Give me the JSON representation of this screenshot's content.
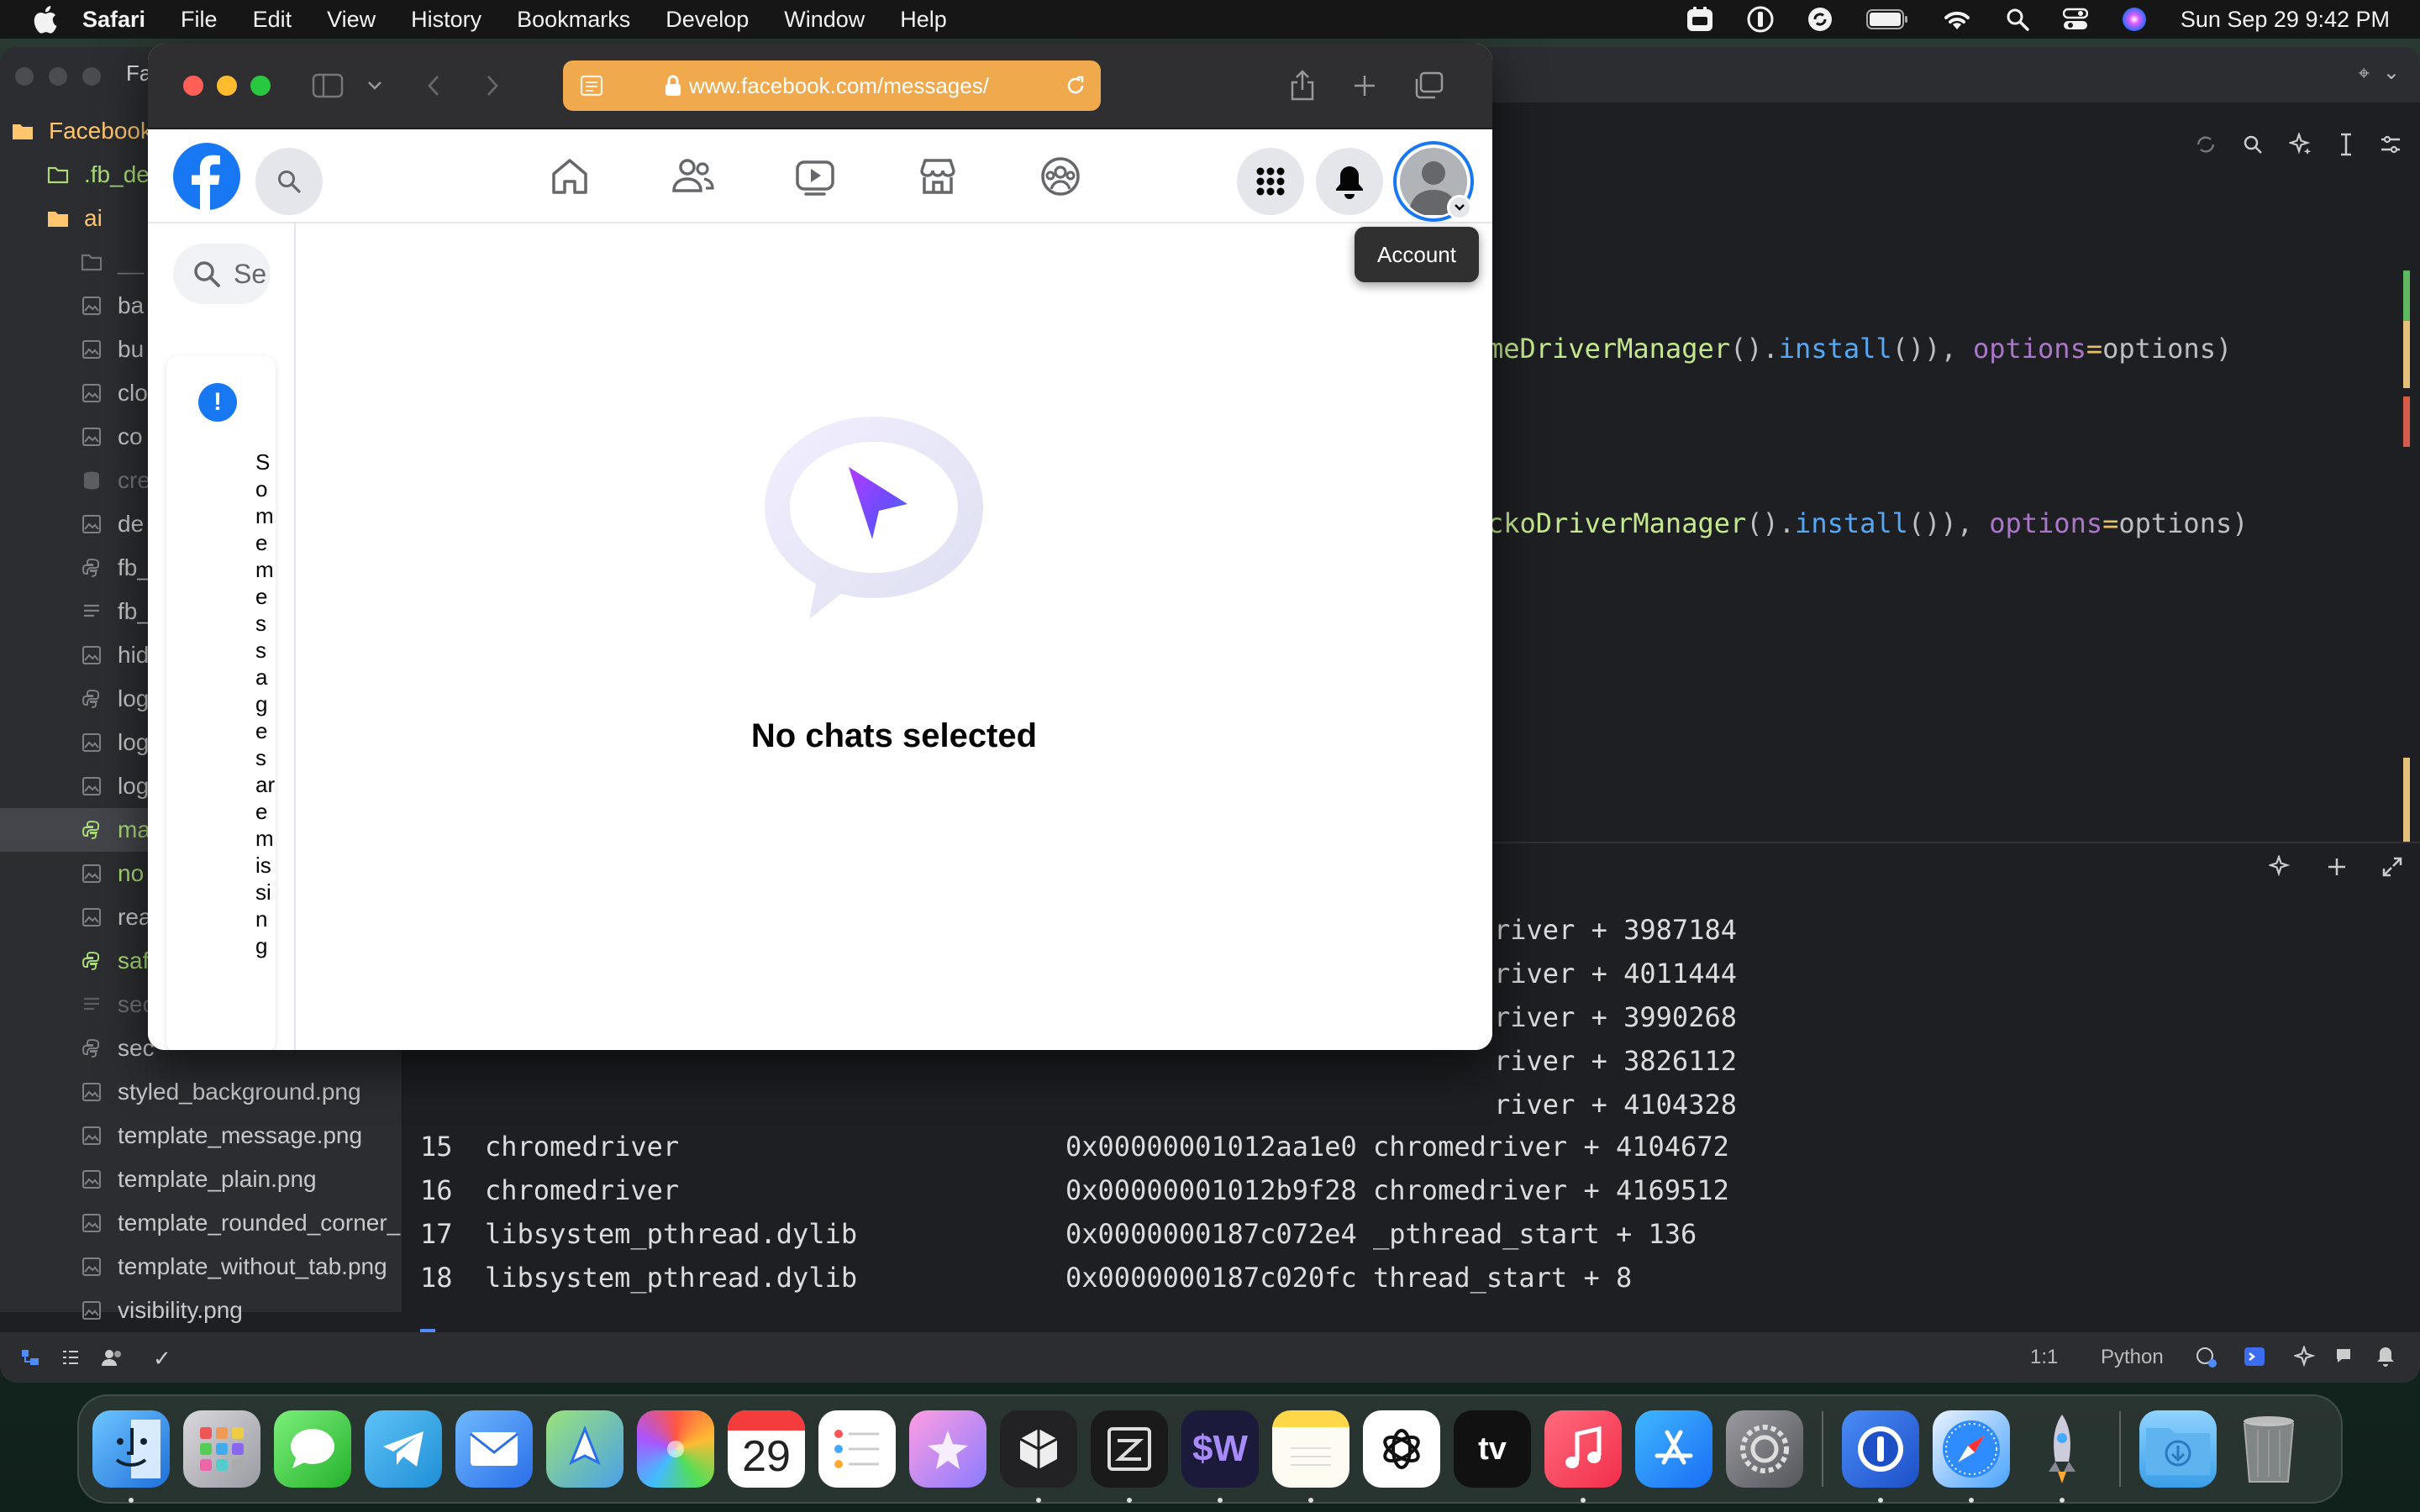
{
  "menubar": {
    "app_name": "Safari",
    "items": [
      "File",
      "Edit",
      "View",
      "History",
      "Bookmarks",
      "Develop",
      "Window",
      "Help"
    ],
    "clock": "Sun Sep 29  9:42 PM",
    "status_icons": [
      "calendar-sync-icon",
      "password-icon",
      "sync-icon",
      "battery-icon",
      "wifi-icon",
      "spotlight-search-icon",
      "control-center-icon",
      "siri-icon"
    ]
  },
  "ide": {
    "window_tab": "Fa",
    "tree": [
      {
        "label": "Facebook",
        "type": "folder",
        "color": "#ffc66d"
      },
      {
        "label": ".fb_de",
        "type": "folder-outline",
        "color": "#a9dc76"
      },
      {
        "label": "ai",
        "type": "folder",
        "color": "#ffc66d"
      },
      {
        "label": "__",
        "type": "folder-outline",
        "color": "#6f737a"
      },
      {
        "label": "ba",
        "type": "image",
        "color": "#7d8086"
      },
      {
        "label": "bu",
        "type": "image",
        "color": "#7d8086"
      },
      {
        "label": "clo",
        "type": "image",
        "color": "#7d8086"
      },
      {
        "label": "co",
        "type": "image",
        "color": "#7d8086"
      },
      {
        "label": "cre",
        "type": "db",
        "color": "#5b5e63"
      },
      {
        "label": "de",
        "type": "image",
        "color": "#7d8086"
      },
      {
        "label": "fb_",
        "type": "python",
        "color": "#7d8086"
      },
      {
        "label": "fb_",
        "type": "text",
        "color": "#7d8086"
      },
      {
        "label": "hid",
        "type": "image",
        "color": "#7d8086"
      },
      {
        "label": "log",
        "type": "python",
        "color": "#7d8086"
      },
      {
        "label": "log",
        "type": "image",
        "color": "#7d8086"
      },
      {
        "label": "log",
        "type": "image",
        "color": "#7d8086"
      },
      {
        "label": "ma",
        "type": "python",
        "color": "#a9dc76",
        "selected": true
      },
      {
        "label": "no",
        "type": "image",
        "color": "#a9dc76"
      },
      {
        "label": "rea",
        "type": "image",
        "color": "#7d8086"
      },
      {
        "label": "saf",
        "type": "python",
        "color": "#a9dc76"
      },
      {
        "label": "sec",
        "type": "text",
        "color": "#5b5e63"
      },
      {
        "label": "sec",
        "type": "python",
        "color": "#7d8086"
      },
      {
        "label": "styled_background.png",
        "type": "image",
        "color": "#7d8086"
      },
      {
        "label": "template_message.png",
        "type": "image",
        "color": "#7d8086"
      },
      {
        "label": "template_plain.png",
        "type": "image",
        "color": "#7d8086"
      },
      {
        "label": "template_rounded_corner_",
        "type": "image",
        "color": "#7d8086"
      },
      {
        "label": "template_without_tab.png",
        "type": "image",
        "color": "#7d8086"
      },
      {
        "label": "visibility.png",
        "type": "image",
        "color": "#7d8086"
      }
    ],
    "code_line_1": {
      "cls": "meDriverManager",
      "rest1": "().",
      "fn": "install",
      "rest2": "()), ",
      "param": "options",
      "eq": "=",
      "val": "options)"
    },
    "code_line_2": {
      "cls": "ckoDriverManager",
      "rest1": "().",
      "fn": "install",
      "rest2": "()), ",
      "param": "options",
      "eq": "=",
      "val": "options)"
    },
    "terminal_partial": [
      "river + 3987184",
      "river + 4011444",
      "river + 3990268",
      "river + 3826112",
      "river + 4104328"
    ],
    "terminal_full": [
      {
        "num": "15",
        "lib": "chromedriver",
        "addr": "0x00000001012aa1e0",
        "sym": "chromedriver + 4104672"
      },
      {
        "num": "16",
        "lib": "chromedriver",
        "addr": "0x00000001012b9f28",
        "sym": "chromedriver + 4169512"
      },
      {
        "num": "17",
        "lib": "libsystem_pthread.dylib",
        "addr": "0x0000000187c072e4",
        "sym": "_pthread_start + 136"
      },
      {
        "num": "18",
        "lib": "libsystem_pthread.dylib",
        "addr": "0x0000000187c020fc",
        "sym": "thread_start + 8"
      }
    ],
    "status": {
      "position": "1:1",
      "language": "Python"
    }
  },
  "safari": {
    "url": "www.facebook.com/messages/",
    "buttons": [
      "sidebar-toggle",
      "tab-group-menu",
      "back",
      "forward",
      "share",
      "new-tab",
      "tab-overview"
    ]
  },
  "facebook": {
    "nav_items": [
      "home-icon",
      "friends-icon",
      "watch-icon",
      "marketplace-icon",
      "groups-icon"
    ],
    "search_placeholder": "Se",
    "alert_text": "Some messages are missing",
    "empty_title": "No chats selected",
    "tooltip": "Account",
    "brand_color": "#1877f2"
  },
  "dock": {
    "apps": [
      {
        "name": "finder-icon",
        "label": "",
        "bg": "linear-gradient(135deg,#6ec6ff,#1e6fd9)",
        "running": true
      },
      {
        "name": "launchpad-icon",
        "label": "",
        "bg": "linear-gradient(135deg,#d8d8dc,#9a9aa2)",
        "running": false
      },
      {
        "name": "messages-icon",
        "label": "",
        "bg": "linear-gradient(135deg,#7df07a,#24b12c)",
        "running": false
      },
      {
        "name": "telegram-icon",
        "label": "",
        "bg": "linear-gradient(135deg,#5ec2f7,#1f8fd6)",
        "running": false
      },
      {
        "name": "mail-icon",
        "label": "",
        "bg": "linear-gradient(135deg,#6fb9ff,#2a6ee8)",
        "running": false
      },
      {
        "name": "maps-icon",
        "label": "",
        "bg": "linear-gradient(135deg,#9be37a,#4aa0e8)",
        "running": false
      },
      {
        "name": "photos-icon",
        "label": "",
        "bg": "conic-gradient(#f54,#fb3,#5d5,#4bf,#a5f,#f54)",
        "running": false
      },
      {
        "name": "calendar-icon",
        "label": "29",
        "bg": "#ffffff",
        "running": false
      },
      {
        "name": "reminders-icon",
        "label": "",
        "bg": "#ffffff",
        "running": false
      },
      {
        "name": "pixelmator-icon",
        "label": "",
        "bg": "linear-gradient(135deg,#ff9de2,#8a7bff)",
        "running": false
      },
      {
        "name": "cube-app-icon",
        "label": "",
        "bg": "#222224",
        "running": true
      },
      {
        "name": "zed-editor-icon",
        "label": "",
        "bg": "#1a1a1a",
        "running": true
      },
      {
        "name": "warp-terminal-icon",
        "label": "$W",
        "bg": "#1c1a3a",
        "running": true
      },
      {
        "name": "notes-icon",
        "label": "",
        "bg": "linear-gradient(180deg,#ffd84a 0 22%,#fdfbf2 22%)",
        "running": true
      },
      {
        "name": "chatgpt-icon",
        "label": "",
        "bg": "#ffffff",
        "running": false
      },
      {
        "name": "apple-tv-icon",
        "label": "tv",
        "bg": "#111111",
        "running": false
      },
      {
        "name": "music-icon",
        "label": "",
        "bg": "linear-gradient(135deg,#ff6b7e,#f22e4a)",
        "running": true
      },
      {
        "name": "app-store-icon",
        "label": "",
        "bg": "linear-gradient(135deg,#3fb7ff,#1a6ef5)",
        "running": false
      },
      {
        "name": "system-settings-icon",
        "label": "",
        "bg": "linear-gradient(135deg,#9a9aa0,#55565c)",
        "running": false
      },
      {
        "name": "1password-icon",
        "label": "",
        "bg": "linear-gradient(135deg,#4a8cf7,#1d4fc7)",
        "running": true
      },
      {
        "name": "safari-icon",
        "label": "",
        "bg": "linear-gradient(135deg,#e9f2ff,#4aa3ff)",
        "running": true
      },
      {
        "name": "rocket-app-icon",
        "label": "",
        "bg": "transparent",
        "running": true
      },
      {
        "name": "downloads-folder-icon",
        "label": "",
        "bg": "linear-gradient(180deg,#8fd3ff,#3a9ee8)",
        "running": false
      },
      {
        "name": "trash-icon",
        "label": "",
        "bg": "transparent",
        "running": false
      }
    ]
  }
}
